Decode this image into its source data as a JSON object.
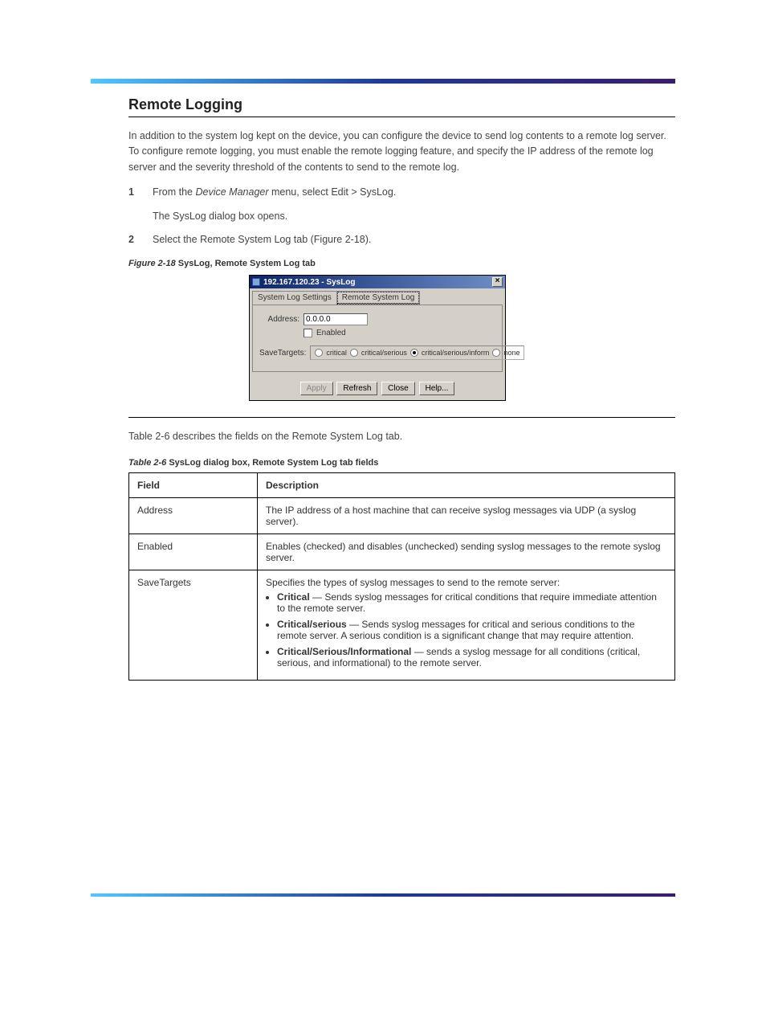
{
  "section": {
    "title": "Remote Logging",
    "intro": "In addition to the system log kept on the device, you can configure the device to send log contents to a remote log server. To configure remote logging, you must enable the remote logging feature, and specify the IP address of the remote log server and the severity threshold of the contents to send to the remote log.",
    "step1_num": "1",
    "step1_body_pre": "From the ",
    "step1_body_italic": "Device Manager",
    "step1_body_post": " menu, select Edit > SysLog.",
    "step1_after": "The SysLog dialog box opens.",
    "step2_num": "2",
    "step2_body": "Select the Remote System Log tab (Figure 2-18).",
    "figure_label": "Figure 2-18",
    "figure_title": "SysLog, Remote System Log tab"
  },
  "dialog": {
    "title": "192.167.120.23 - SysLog",
    "tab1": "System Log Settings",
    "tab2": "Remote System Log",
    "address_label": "Address:",
    "address_value": "0.0.0.0",
    "enabled_label": "Enabled",
    "savetargets_label": "SaveTargets:",
    "radio_critical": "critical",
    "radio_critserious": "critical/serious",
    "radio_critseriousinform": "critical/serious/inform",
    "radio_none": "none",
    "btn_apply": "Apply",
    "btn_refresh": "Refresh",
    "btn_close": "Close",
    "btn_help": "Help..."
  },
  "table_section": {
    "after_rule_text": "Table 2-6 describes the fields on the Remote System Log tab.",
    "caption_label": "Table 2-6",
    "caption_title": "SysLog dialog box, Remote System Log tab fields",
    "header_field": "Field",
    "header_desc": "Description",
    "rows": [
      {
        "field": "Address",
        "desc": "The IP address of a host machine that can receive syslog messages via UDP (a syslog server)."
      },
      {
        "field": "Enabled",
        "desc": "Enables (checked) and disables (unchecked) sending syslog messages to the remote syslog server."
      },
      {
        "field": "SaveTargets",
        "desc_intro": "Specifies the types of syslog messages to send to the remote server:",
        "items": [
          {
            "label": "Critical",
            "text": " — Sends syslog messages for critical conditions that require immediate attention to the remote server."
          },
          {
            "label": "Critical/serious",
            "text": " — Sends syslog messages for critical and serious conditions to the remote server. A serious condition is a significant change that may require attention."
          },
          {
            "label": "Critical/Serious/Informational",
            "text": " — sends a syslog message for all conditions (critical, serious, and informational) to the remote server."
          }
        ]
      }
    ]
  }
}
